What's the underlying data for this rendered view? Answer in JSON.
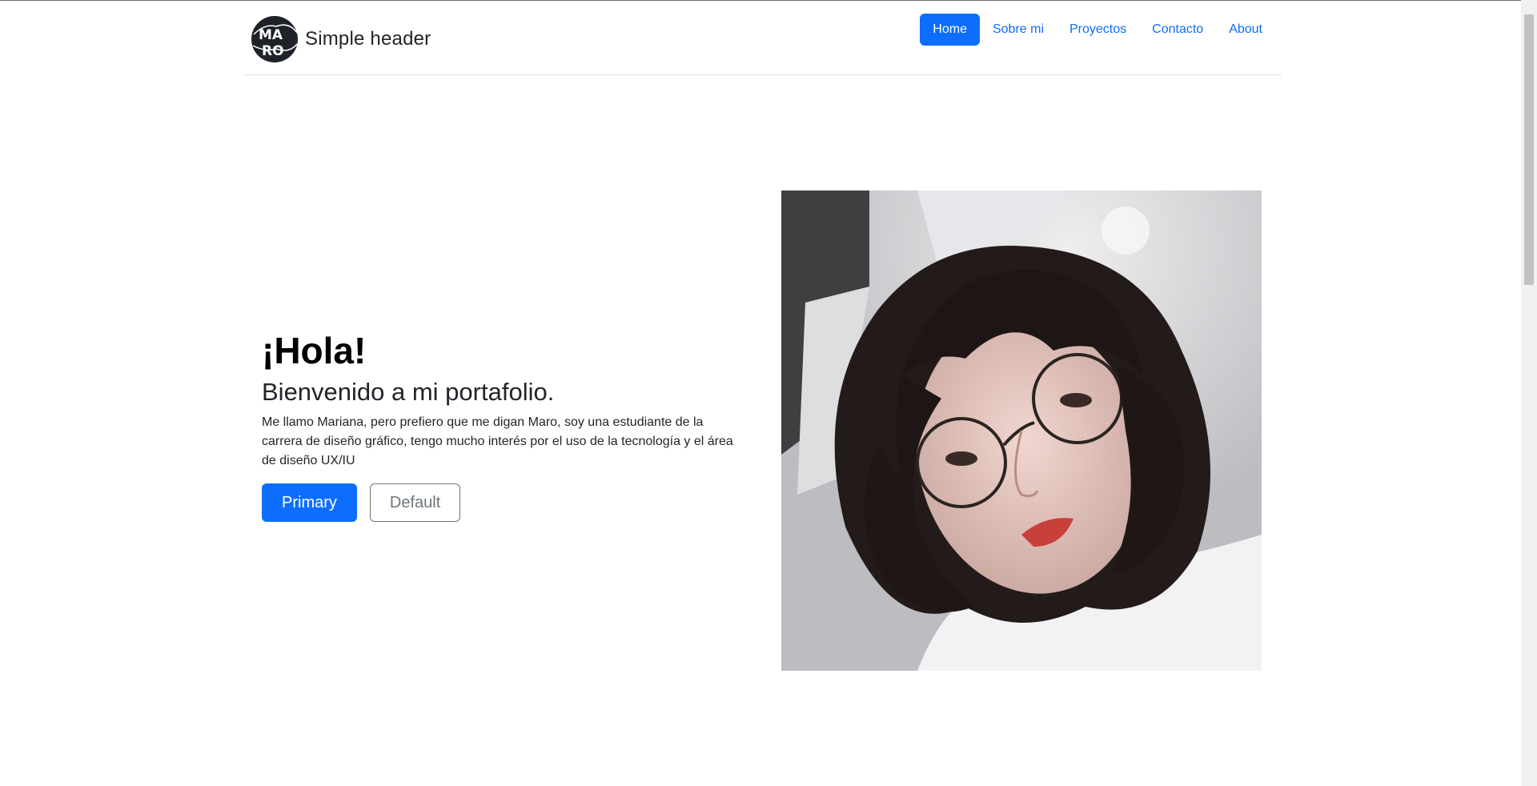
{
  "header": {
    "brand_text": "Simple header",
    "logo_letters": [
      "MA",
      "RO"
    ],
    "nav": [
      {
        "label": "Home",
        "active": true
      },
      {
        "label": "Sobre mi",
        "active": false
      },
      {
        "label": "Proyectos",
        "active": false
      },
      {
        "label": "Contacto",
        "active": false
      },
      {
        "label": "About",
        "active": false
      }
    ]
  },
  "hero": {
    "title": "¡Hola!",
    "subtitle": "Bienvenido a mi portafolio.",
    "lead": "Me llamo Mariana, pero prefiero que me digan Maro, soy una estudiante de la carrera de diseño gráfico, tengo mucho interés por el uso de la tecnología y el área de diseño UX/IU",
    "primary_button": "Primary",
    "default_button": "Default"
  },
  "colors": {
    "accent": "#0d6efd",
    "text": "#212529",
    "muted": "#6c757d",
    "divider": "#dee2e6"
  }
}
